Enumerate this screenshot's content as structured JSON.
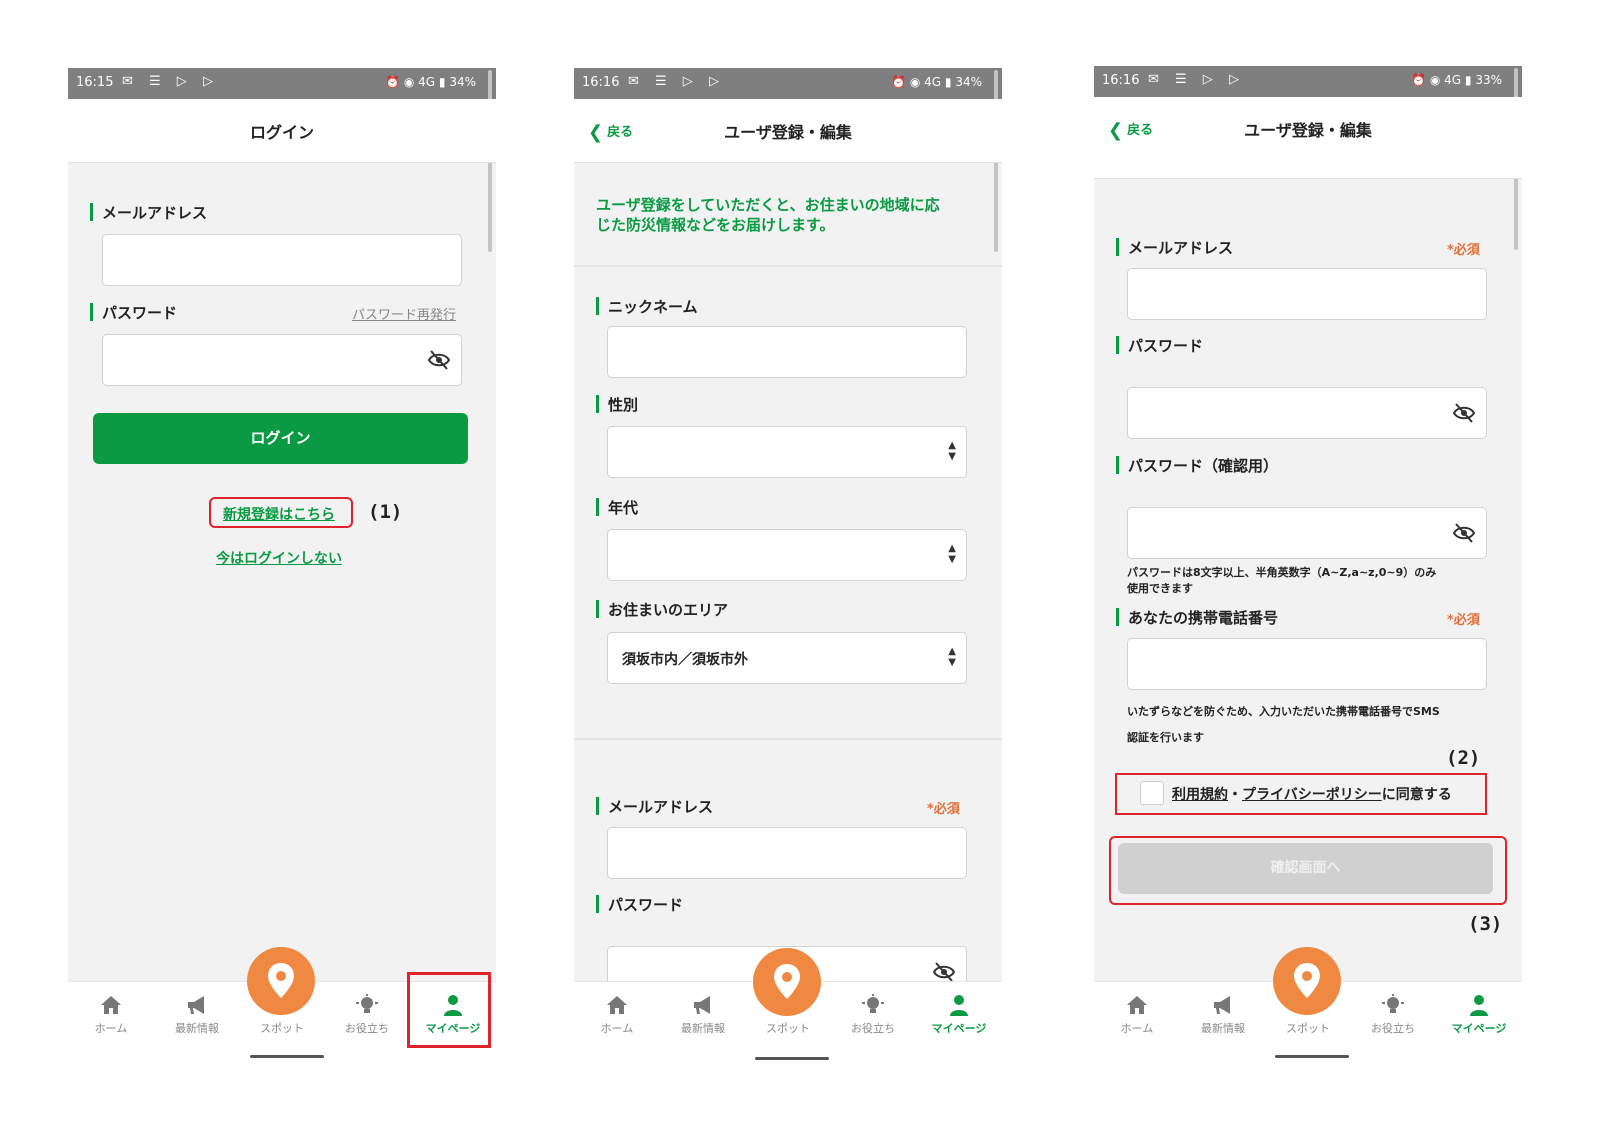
{
  "status_left": {
    "icons": "✉ ☰ ▷ ▷"
  },
  "status_right_icons": "⏰ ◉ 4G",
  "screens": [
    {
      "time": "16:15",
      "battery": "34%",
      "title": "ログイン",
      "email_label": "メールアドレス",
      "password_label": "パスワード",
      "password_reissue": "パスワード再発行",
      "login_button": "ログイン",
      "register_link": "新規登録はこちら",
      "annot1": "(1)",
      "skip_login": "今はログインしない"
    },
    {
      "time": "16:16",
      "battery": "34%",
      "back": "戻る",
      "title": "ユーザ登録・編集",
      "intro_line1": "ユーザ登録をしていただくと、お住まいの地域に応",
      "intro_line2": "じた防災情報などをお届けします。",
      "nickname_label": "ニックネーム",
      "gender_label": "性別",
      "age_label": "年代",
      "area_label": "お住まいのエリア",
      "area_value": "須坂市内／須坂市外",
      "email_label": "メールアドレス",
      "required": "*必須",
      "password_label": "パスワード"
    },
    {
      "time": "16:16",
      "battery": "33%",
      "back": "戻る",
      "title": "ユーザ登録・編集",
      "email_label": "メールアドレス",
      "required": "*必須",
      "password_label": "パスワード",
      "password_confirm_label": "パスワード（確認用）",
      "password_note_line1": "パスワードは8文字以上、半角英数字（A~Z,a~z,0~9）のみ",
      "password_note_line2": "使用できます",
      "phone_label": "あなたの携帯電話番号",
      "phone_required": "*必須",
      "phone_note_line1": "いたずらなどを防ぐため、入力いただいた携帯電話番号でSMS",
      "phone_note_line2": "認証を行います",
      "annot2": "(2)",
      "terms_link": "利用規約",
      "dot": "・",
      "privacy_link": "プライバシーポリシー",
      "agree_text": "に同意する",
      "confirm_button": "確認画面へ",
      "annot3": "(3)"
    }
  ],
  "tabs": [
    {
      "label": "ホーム",
      "icon": "home-icon"
    },
    {
      "label": "最新情報",
      "icon": "megaphone-icon"
    },
    {
      "label": "スポット",
      "icon": "map-pin-icon"
    },
    {
      "label": "お役立ち",
      "icon": "lightbulb-icon"
    },
    {
      "label": "マイページ",
      "icon": "user-icon"
    }
  ],
  "colors": {
    "green": "#0a9a44",
    "orange": "#ef8840",
    "required": "#e0703b",
    "highlight": "#e0242c"
  }
}
